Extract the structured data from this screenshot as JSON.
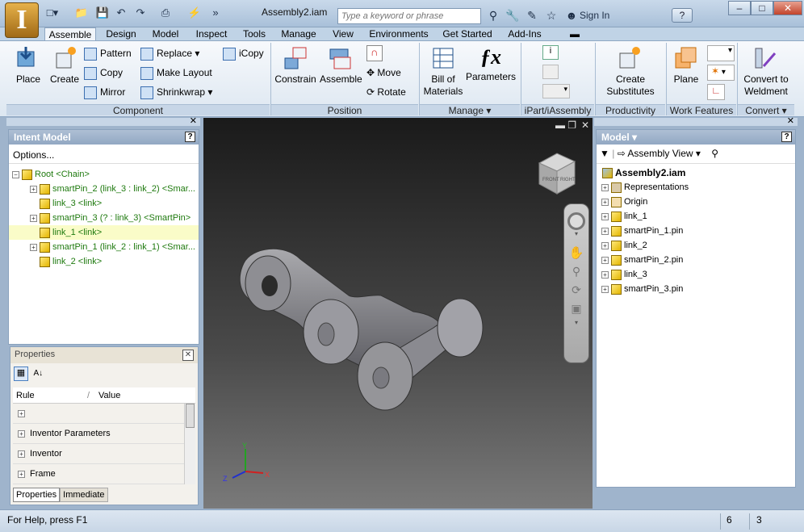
{
  "window": {
    "title": "Assembly2.iam",
    "search_placeholder": "Type a keyword or phrase",
    "sign_in": "Sign In",
    "help_button": "?",
    "min_label": "–",
    "max_label": "□",
    "close_label": "✕"
  },
  "app_button": {
    "label": "I"
  },
  "tabs": [
    "Assemble",
    "Design",
    "Model",
    "Inspect",
    "Tools",
    "Manage",
    "View",
    "Environments",
    "Get Started",
    "Add-Ins"
  ],
  "ribbon": {
    "place": "Place",
    "create": "Create",
    "pattern": "Pattern",
    "copy": "Copy",
    "mirror": "Mirror",
    "replace": "Replace",
    "make_layout": "Make Layout",
    "shrinkwrap": "Shrinkwrap",
    "icopy": "iCopy",
    "constrain": "Constrain",
    "assemble": "Assemble",
    "move": "Move",
    "rotate": "Rotate",
    "bom1": "Bill of",
    "bom2": "Materials",
    "parameters": "Parameters",
    "create_subs1": "Create",
    "create_subs2": "Substitutes",
    "plane": "Plane",
    "convert1": "Convert to",
    "convert2": "Weldment",
    "groups": {
      "component": "Component",
      "position": "Position",
      "manage": "Manage",
      "ipart": "iPart/iAssembly",
      "productivity": "Productivity",
      "work_features": "Work Features",
      "convert": "Convert"
    }
  },
  "intent_panel": {
    "title": "Intent Model",
    "options": "Options...",
    "tree": [
      {
        "label": "Root <Chain>",
        "level": 0,
        "expand": "−",
        "highlight": false
      },
      {
        "label": "smartPin_2 (link_3 : link_2) <Smar...",
        "level": 1,
        "expand": "+",
        "highlight": false
      },
      {
        "label": "link_3 <link>",
        "level": 1,
        "expand": "",
        "highlight": false
      },
      {
        "label": "smartPin_3 (? : link_3) <SmartPin>",
        "level": 1,
        "expand": "+",
        "highlight": false
      },
      {
        "label": "link_1 <link>",
        "level": 1,
        "expand": "",
        "highlight": true
      },
      {
        "label": "smartPin_1 (link_2 : link_1) <Smar...",
        "level": 1,
        "expand": "+",
        "highlight": false
      },
      {
        "label": "link_2 <link>",
        "level": 1,
        "expand": "",
        "highlight": false
      }
    ]
  },
  "properties_panel": {
    "title": "Properties",
    "col_rule": "Rule",
    "col_value": "Value",
    "rows": [
      "",
      "Inventor Parameters",
      "Inventor",
      "Frame"
    ],
    "tabs": [
      "Properties",
      "Immediate"
    ]
  },
  "model_panel": {
    "title": "Model",
    "view": "Assembly View",
    "root": "Assembly2.iam",
    "items": [
      "Representations",
      "Origin",
      "link_1",
      "smartPin_1.pin",
      "link_2",
      "smartPin_2.pin",
      "link_3",
      "smartPin_3.pin"
    ]
  },
  "viewcube": {
    "faces": [
      "FRONT",
      "RIGHT"
    ]
  },
  "triad": {
    "x": "X",
    "y": "Y",
    "z": "Z"
  },
  "status": {
    "help": "For Help, press F1",
    "count1": "6",
    "count2": "3"
  }
}
